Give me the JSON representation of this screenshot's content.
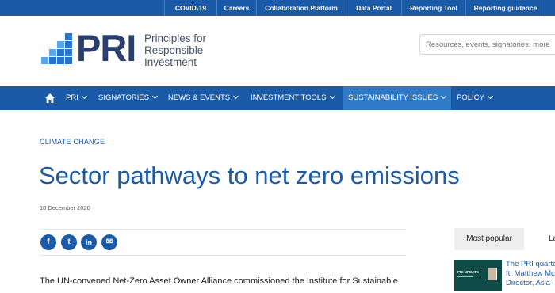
{
  "top_links": [
    "COVID-19",
    "Careers",
    "Collaboration Platform",
    "Data Portal",
    "Reporting Tool",
    "Reporting guidance"
  ],
  "logo": {
    "wordmark": "PRI",
    "line1": "Principles for",
    "line2": "Responsible",
    "line3": "Investment",
    "colors": [
      "#2a73c8",
      "#59a7e8"
    ]
  },
  "search": {
    "placeholder": "Resources, events, signatories, more..."
  },
  "nav": {
    "home_icon": "home-icon",
    "items": [
      "PRI",
      "SIGNATORIES",
      "NEWS & EVENTS",
      "INVESTMENT TOOLS",
      "SUSTAINABILITY ISSUES",
      "POLICY"
    ],
    "active": "SUSTAINABILITY ISSUES"
  },
  "article": {
    "category": "CLIMATE CHANGE",
    "title": "Sector pathways to net zero emissions",
    "date": "10 December 2020",
    "share": [
      "f",
      "t",
      "in",
      "✉"
    ],
    "body_first_line": "The UN-convened Net-Zero Asset Owner Alliance commissioned the Institute for Sustainable"
  },
  "sidebar": {
    "tabs": [
      "Most popular",
      "La"
    ],
    "item": {
      "thumb_label": "PRI UPDATE",
      "title_lines": [
        "The PRI quarte",
        "ft. Matthew Mc",
        "Director, Asia-"
      ]
    }
  },
  "colors": {
    "primary": "#1b5aa6",
    "active_nav": "#2f7ac6"
  }
}
